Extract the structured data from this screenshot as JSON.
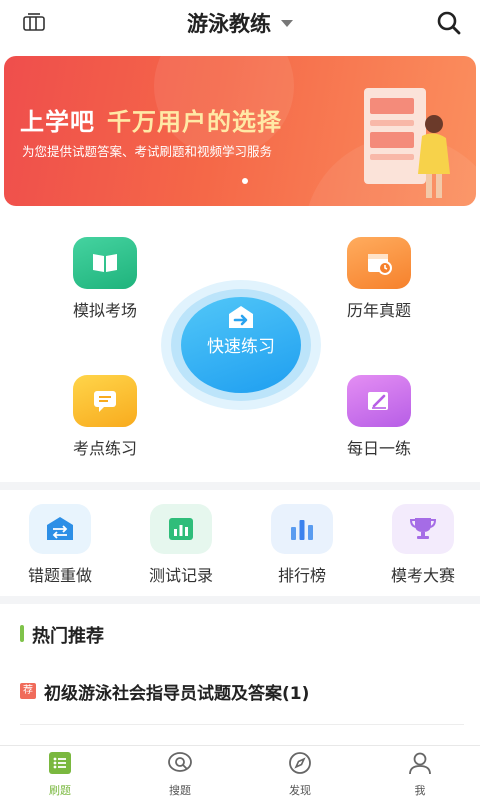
{
  "header": {
    "title": "游泳教练",
    "menu_icon": "apps-icon",
    "search_icon": "search-icon"
  },
  "banner": {
    "headline_part1": "上学吧",
    "headline_part2": "千万用户的选择",
    "subline": "为您提供试题答案、考试刷题和视频学习服务"
  },
  "features": {
    "mock_exam": "模拟考场",
    "past_papers": "历年真题",
    "quick_practice": "快速练习",
    "topic_practice": "考点练习",
    "daily_practice": "每日一练"
  },
  "secondary": {
    "wrong_redo": "错题重做",
    "test_records": "测试记录",
    "leaderboard": "排行榜",
    "mock_contest": "模考大赛"
  },
  "hot": {
    "section_title": "热门推荐",
    "tag": "荐",
    "item_title": "初级游泳社会指导员试题及答案(1)"
  },
  "nav": {
    "practice": "刷题",
    "search": "搜题",
    "discover": "发现",
    "me": "我"
  },
  "colors": {
    "accent_green": "#7ab83f",
    "banner_start": "#ef4e4c",
    "banner_end": "#fb8f5e",
    "quick_practice": "#1e9ef0"
  }
}
